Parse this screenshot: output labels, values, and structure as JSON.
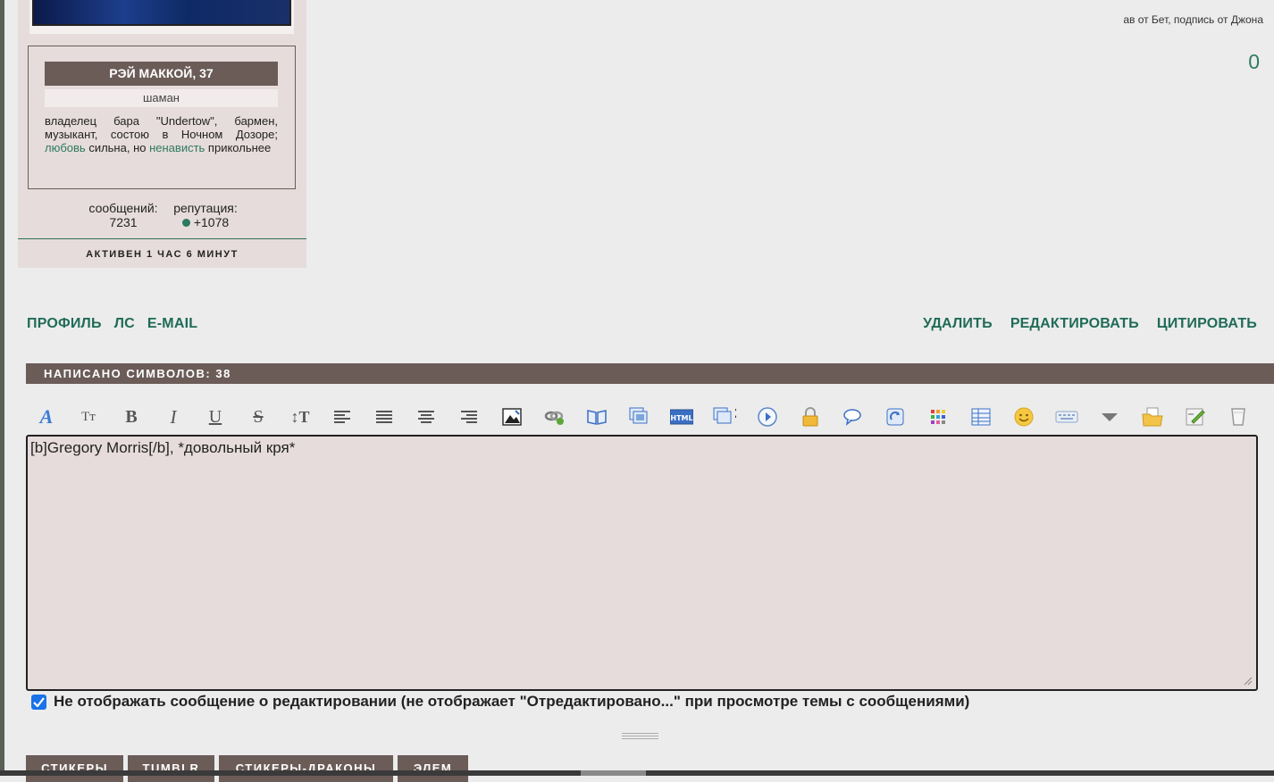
{
  "profile": {
    "name": "РЭЙ МАККОЙ, 37",
    "role": "шаман",
    "desc_plain_1": "владелец бара \"Undertow\", бармен, музыкант, состою в Ночном Дозоре; ",
    "desc_link_1": "любовь",
    "desc_plain_2": " сильна, но ",
    "desc_link_2": "ненависть",
    "desc_plain_3": " прикольнее",
    "posts_label": "сообщений:",
    "posts_value": "7231",
    "rep_label": "репутация:",
    "rep_value": "+1078",
    "active": "АКТИВЕН 1 ЧАС 6 МИНУТ"
  },
  "signature": "ав от Бет, подпись от Джона",
  "counter": "0",
  "post_links_left": [
    "ПРОФИЛЬ",
    "ЛС",
    "E-MAIL"
  ],
  "post_links_right": [
    "УДАЛИТЬ",
    "РЕДАКТИРОВАТЬ",
    "ЦИТИРОВАТЬ"
  ],
  "char_count": "НАПИСАНО СИМВОЛОВ: 38",
  "editor": {
    "text": "[b]Gregory Morris[/b], *довольный кря*"
  },
  "checkbox_label": "Не отображать сообщение о редактировании (не отображает \"Отредактировано...\" при просмотре темы с сообщениями)",
  "tabs": [
    "СТИКЕРЫ",
    "TUMBLR",
    "СТИКЕРЫ-ДРАКОНЫ",
    "ЭЛЕМ"
  ],
  "toolbar_icons": [
    "font-color-icon",
    "font-size-icon",
    "bold-icon",
    "italic-icon",
    "underline-icon",
    "strikethrough-icon",
    "text-direction-icon",
    "align-left-icon",
    "align-justify-icon",
    "align-center-icon",
    "align-right-icon",
    "image-icon",
    "link-icon",
    "book-icon",
    "gallery-icon",
    "html-icon",
    "copy-2-icon",
    "play-icon",
    "lock-icon",
    "speech-icon",
    "refresh-icon",
    "color-grid-icon",
    "table-icon",
    "smiley-icon",
    "keyboard-icon",
    "dropdown-icon",
    "folder-icon",
    "edit-icon",
    "glass-icon"
  ],
  "colors": {
    "accent": "#1f6b57",
    "bar": "#6b5c58",
    "profile_bg": "#e6dcdb",
    "page_bg": "#ececec"
  }
}
